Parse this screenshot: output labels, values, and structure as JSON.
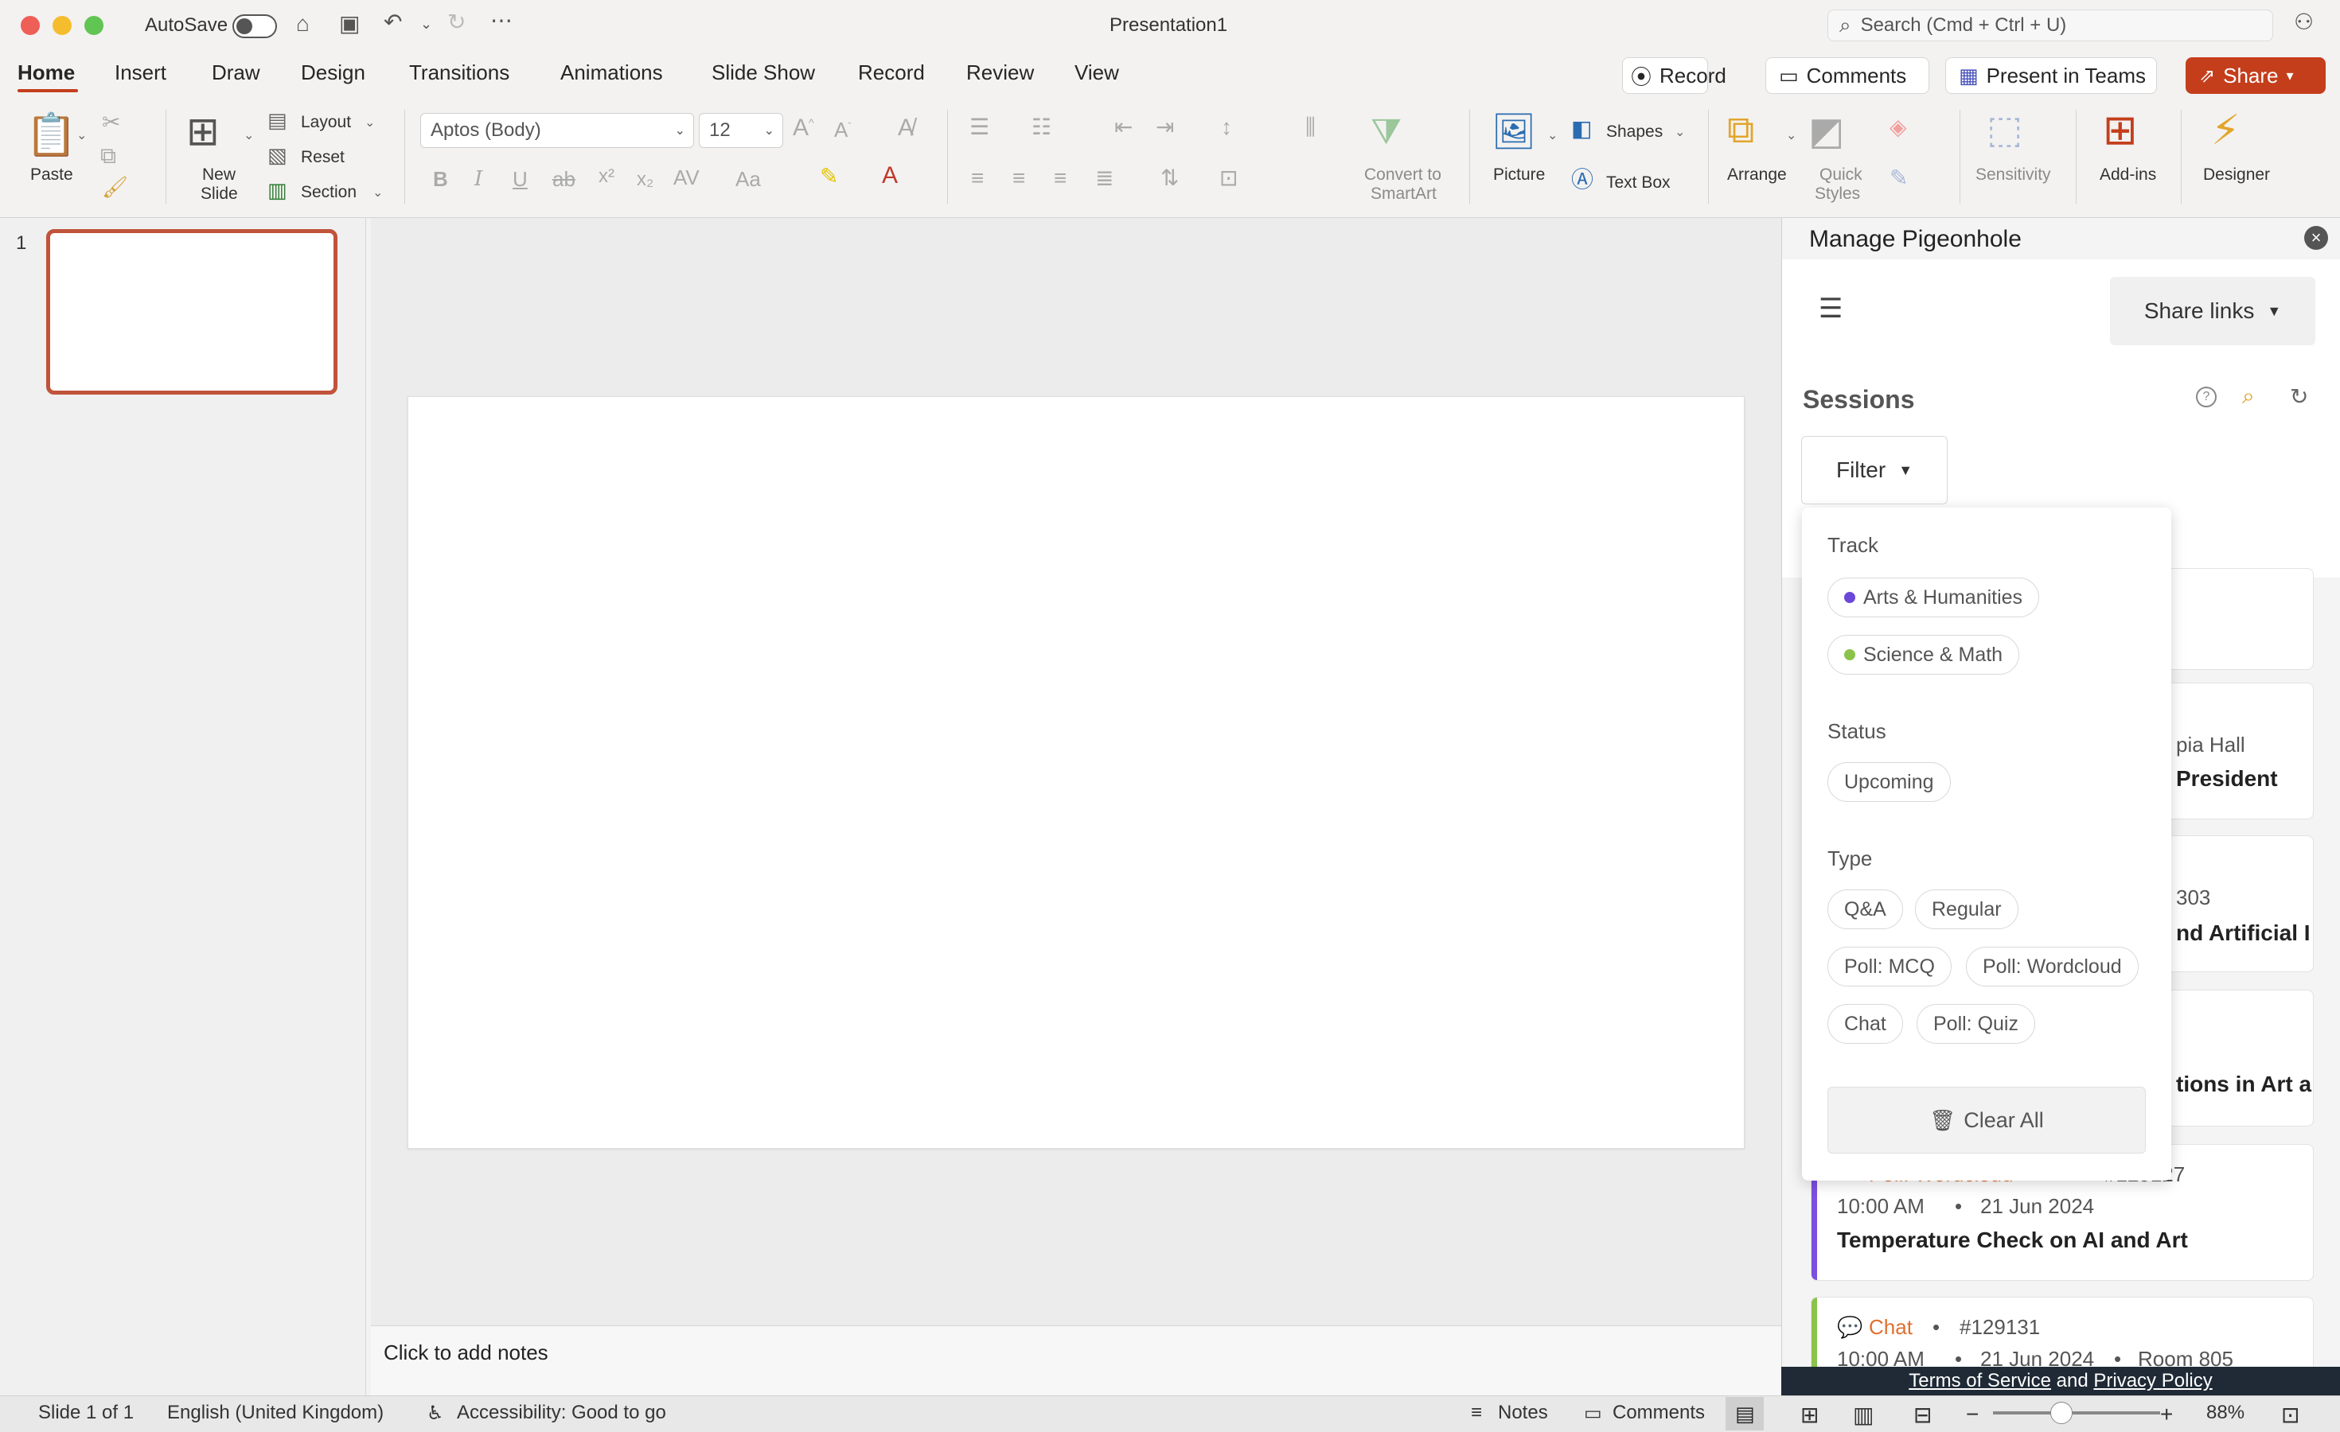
{
  "window": {
    "title": "Presentation1",
    "autosave_label": "AutoSave",
    "search_placeholder": "Search (Cmd + Ctrl + U)"
  },
  "tabs": [
    "Home",
    "Insert",
    "Draw",
    "Design",
    "Transitions",
    "Animations",
    "Slide Show",
    "Record",
    "Review",
    "View"
  ],
  "top_buttons": {
    "record": "Record",
    "comments": "Comments",
    "present": "Present in Teams",
    "share": "Share"
  },
  "ribbon": {
    "paste": "Paste",
    "new_slide": [
      "New",
      "Slide"
    ],
    "layout": "Layout",
    "reset": "Reset",
    "section": "Section",
    "font_name": "Aptos (Body)",
    "font_size": "12",
    "convert": [
      "Convert to",
      "SmartArt"
    ],
    "picture": "Picture",
    "shapes": "Shapes",
    "text_box": "Text Box",
    "arrange": "Arrange",
    "quick_styles": [
      "Quick",
      "Styles"
    ],
    "sensitivity": "Sensitivity",
    "addins": "Add-ins",
    "designer": "Designer"
  },
  "thumbnail_number": "1",
  "notes_placeholder": "Click to add notes",
  "status": {
    "slide": "Slide 1 of 1",
    "language": "English (United Kingdom)",
    "accessibility": "Accessibility: Good to go",
    "notes": "Notes",
    "comments": "Comments",
    "zoom": "88%"
  },
  "pane": {
    "title": "Manage Pigeonhole",
    "share_links": "Share links",
    "sessions_heading": "Sessions",
    "filter_label": "Filter",
    "cards": [
      {
        "partial_text_1": "pia Hall",
        "partial_title": "President"
      },
      {
        "partial_text_1": "303",
        "partial_title": "nd Artificial I"
      },
      {
        "partial_title": "tions in Art a"
      },
      {
        "type": "Poll: Wordcloud",
        "id": "#129127",
        "time": "10:00 AM",
        "date": "21 Jun 2024",
        "title": "Temperature Check on AI and Art"
      },
      {
        "type": "Chat",
        "id": "#129131",
        "time": "10:00 AM",
        "date": "21 Jun 2024",
        "room": "Room 805"
      }
    ],
    "filter_dropdown": {
      "track_label": "Track",
      "tracks": [
        {
          "name": "Arts & Humanities",
          "color": "#6b48d8"
        },
        {
          "name": "Science & Math",
          "color": "#8bc34a"
        }
      ],
      "status_label": "Status",
      "statuses": [
        "Upcoming"
      ],
      "type_label": "Type",
      "types": [
        "Q&A",
        "Regular",
        "Poll: MCQ",
        "Poll: Wordcloud",
        "Chat",
        "Poll: Quiz"
      ],
      "clear_all": "Clear All"
    },
    "footer": {
      "terms": "Terms of Service",
      "and": "and",
      "privacy": "Privacy Policy"
    }
  },
  "colors": {
    "accent": "#c43e1c",
    "purple": "#7b4fe0",
    "green": "#8bc34a",
    "orange": "#e0702f"
  }
}
